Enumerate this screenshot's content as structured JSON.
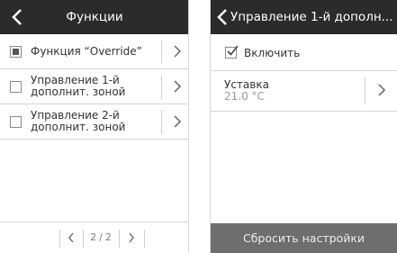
{
  "left_screen": {
    "title": "Функции",
    "items": [
      {
        "label": "Функция “Override”",
        "checked": true
      },
      {
        "label": "Управление 1-й\nдополнит. зоной",
        "checked": false
      },
      {
        "label": "Управление 2-й\nдополнит. зоной",
        "checked": false
      }
    ],
    "pagination": {
      "text": "2 / 2"
    }
  },
  "right_screen": {
    "title": "Управление 1-й дополн...",
    "enable": {
      "label": "Включить",
      "checked": true
    },
    "setpoint": {
      "label": "Уставка",
      "value": "21.0 °C"
    },
    "reset_button": "Сбросить настройки"
  },
  "colors": {
    "header_bg": "#2b2b2b",
    "reset_bg": "#6e6e6e",
    "divider": "#d6d6d6"
  }
}
